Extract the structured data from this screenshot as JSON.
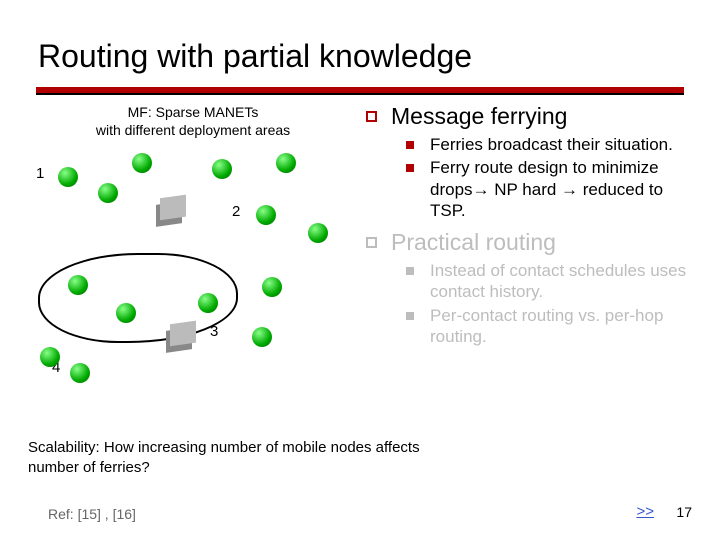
{
  "title": "Routing with partial knowledge",
  "diagram_caption_l1": "MF: Sparse MANETs",
  "diagram_caption_l2": "with different deployment areas",
  "diagram": {
    "labels": {
      "n1": "1",
      "n2": "2",
      "n3": "3",
      "n4": "4"
    }
  },
  "sec1": {
    "title": "Message ferrying",
    "b1": "Ferries broadcast their situation.",
    "b2": "Ferry route design to minimize drops→ NP hard → reduced to TSP."
  },
  "sec2": {
    "title": "Practical routing",
    "b1": "Instead of contact schedules uses contact history.",
    "b2": "Per-contact routing vs. per-hop routing."
  },
  "scalability": "Scalability: How increasing number of mobile nodes affects number of ferries?",
  "ref": "Ref: [15] , [16]",
  "nav": ">>",
  "page": "17"
}
